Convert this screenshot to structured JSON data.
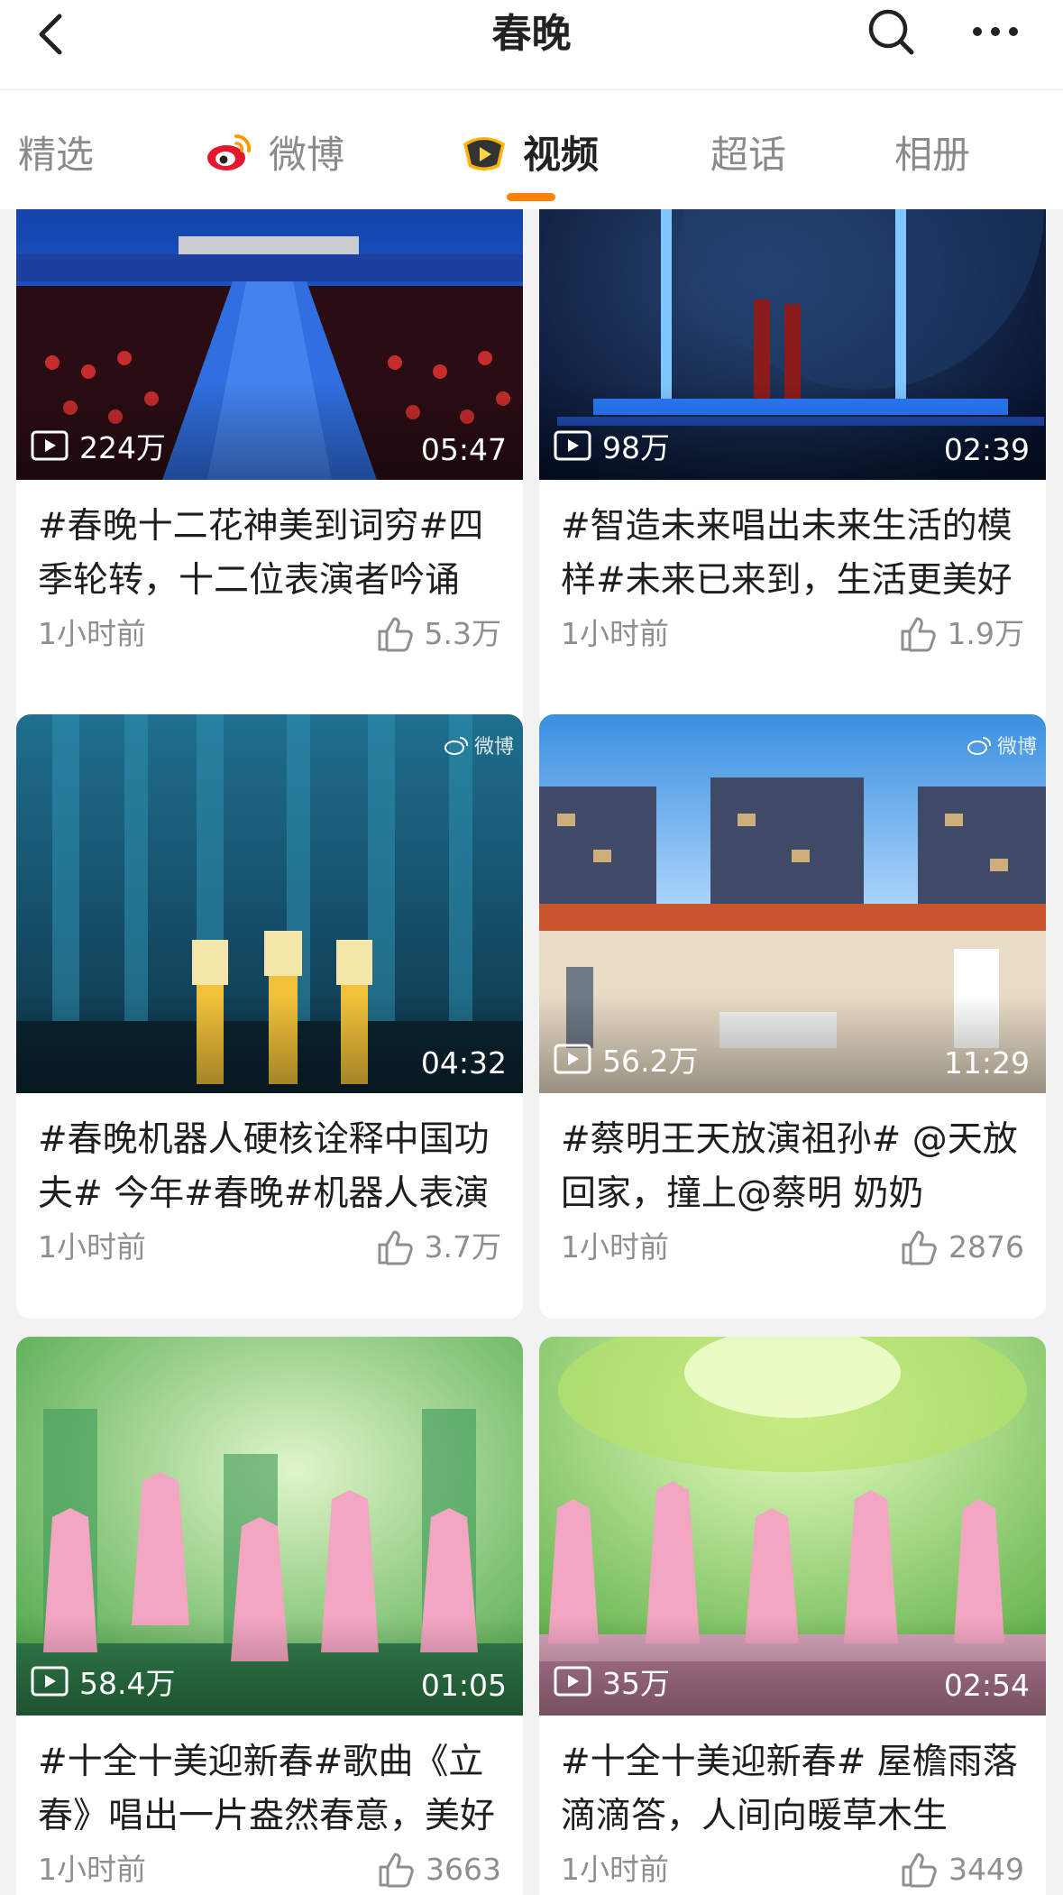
{
  "header": {
    "title": "春晚"
  },
  "tabs": [
    {
      "label": "精选",
      "icon": "",
      "active": false
    },
    {
      "label": "微博",
      "icon": "weibo-logo-icon",
      "active": false
    },
    {
      "label": "视频",
      "icon": "video-tab-icon",
      "active": true
    },
    {
      "label": "超话",
      "icon": "",
      "active": false
    },
    {
      "label": "相册",
      "icon": "",
      "active": false
    }
  ],
  "colors": {
    "accent": "#ff8200",
    "text": "#1e1e1e",
    "muted": "#8f8f8f",
    "background": "#f2f2f2"
  },
  "watermark": "微博",
  "cards": [
    {
      "views": "224万",
      "duration": "05:47",
      "title": "#春晚十二花神美到词穷#四季轮转，十二位表演者吟诵",
      "time": "1小时前",
      "likes": "5.3万",
      "watermark": false
    },
    {
      "views": "98万",
      "duration": "02:39",
      "title": "#智造未来唱出未来生活的模样#未来已来到，生活更美好",
      "time": "1小时前",
      "likes": "1.9万",
      "watermark": false
    },
    {
      "views": "",
      "duration": "04:32",
      "title": "#春晚机器人硬核诠释中国功夫# 今年#春晚#机器人表演",
      "time": "1小时前",
      "likes": "3.7万",
      "watermark": true
    },
    {
      "views": "56.2万",
      "duration": "11:29",
      "title": "#蔡明王天放演祖孙# @天放 回家，撞上@蔡明 奶奶",
      "time": "1小时前",
      "likes": "2876",
      "watermark": true
    },
    {
      "views": "58.4万",
      "duration": "01:05",
      "title": "#十全十美迎新春#歌曲《立春》唱出一片盎然春意，美好",
      "time": "1小时前",
      "likes": "3663",
      "watermark": false
    },
    {
      "views": "35万",
      "duration": "02:54",
      "title": "#十全十美迎新春# 屋檐雨落滴滴答，人间向暖草木生",
      "time": "1小时前",
      "likes": "3449",
      "watermark": false
    }
  ]
}
